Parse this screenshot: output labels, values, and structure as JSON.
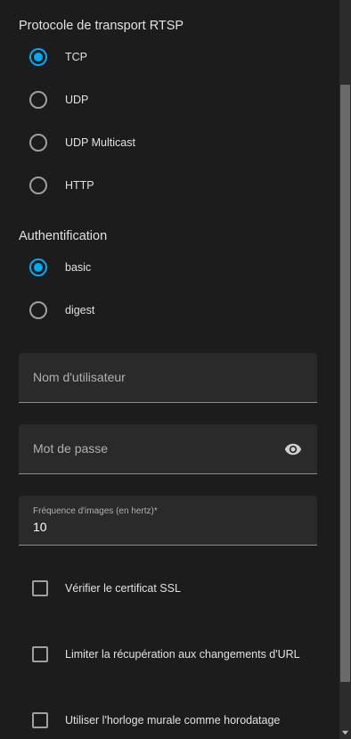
{
  "rtsp": {
    "title": "Protocole de transport RTSP",
    "options": [
      {
        "label": "TCP",
        "checked": true
      },
      {
        "label": "UDP",
        "checked": false
      },
      {
        "label": "UDP Multicast",
        "checked": false
      },
      {
        "label": "HTTP",
        "checked": false
      }
    ]
  },
  "auth": {
    "title": "Authentification",
    "options": [
      {
        "label": "basic",
        "checked": true
      },
      {
        "label": "digest",
        "checked": false
      }
    ]
  },
  "fields": {
    "username_placeholder": "Nom d'utilisateur",
    "password_placeholder": "Mot de passe",
    "framerate_label": "Fréquence d'images (en hertz)*",
    "framerate_value": "10"
  },
  "checkboxes": {
    "verify_ssl": "Vérifier le certificat SSL",
    "limit_refetch": "Limiter la récupération aux changements d'URL",
    "wall_clock": "Utiliser l'horloge murale comme horodatage"
  },
  "icons": {
    "password_toggle": "eye-icon"
  },
  "colors": {
    "accent": "#03a9f4",
    "background": "#1c1c1c",
    "field_background": "#2a2a2a"
  }
}
